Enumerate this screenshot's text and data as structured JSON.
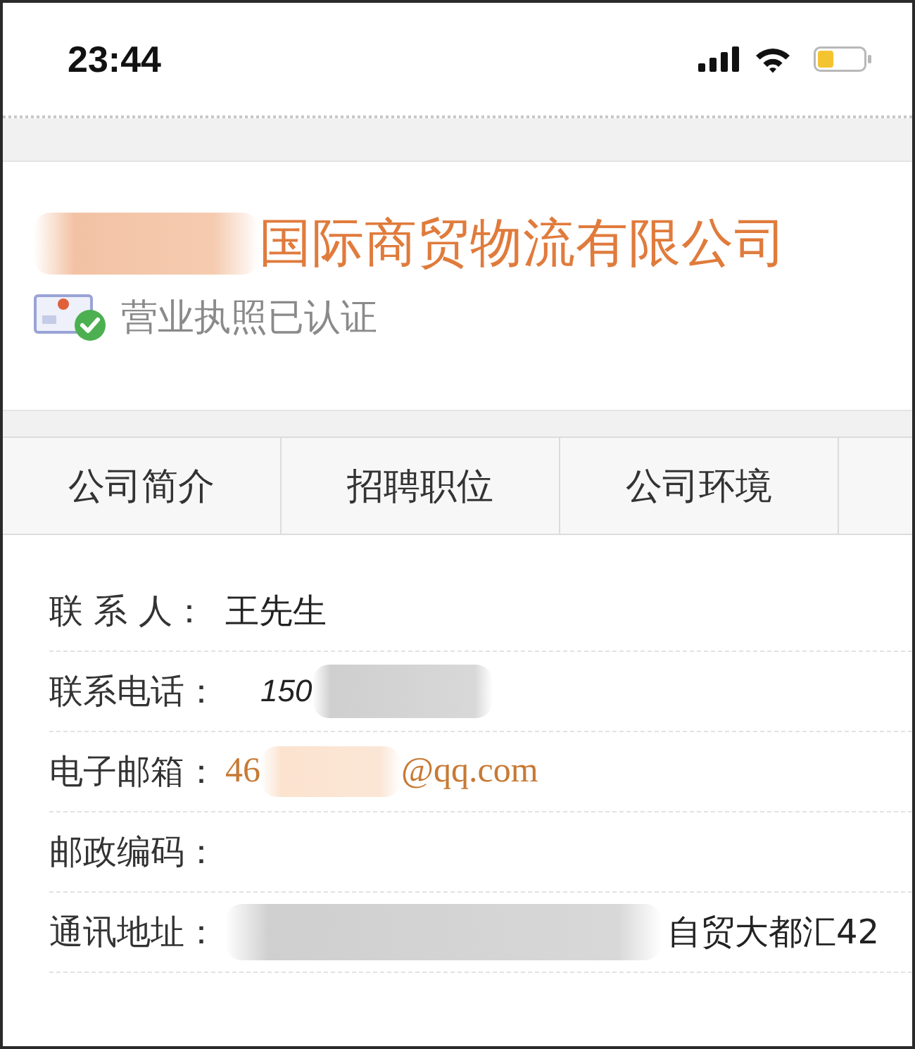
{
  "status_bar": {
    "time": "23:44"
  },
  "company": {
    "name": "国际商贸物流有限公司",
    "verification": "营业执照已认证",
    "verified": true
  },
  "tabs": [
    {
      "label": "公司简介",
      "selected": false
    },
    {
      "label": "招聘职位",
      "selected": false
    },
    {
      "label": "公司环境",
      "selected": false
    }
  ],
  "contact": {
    "rows": [
      {
        "kind": "plain",
        "label": "联 系 人：",
        "value": "王先生"
      },
      {
        "kind": "phone",
        "label": "联系电话：",
        "value": "150"
      },
      {
        "kind": "email",
        "label": "电子邮箱：",
        "prefix": "46",
        "suffix": "@qq.com"
      },
      {
        "kind": "blank",
        "label": "邮政编码："
      },
      {
        "kind": "address",
        "label": "通讯地址：",
        "value": "自贸大都汇42"
      }
    ]
  }
}
